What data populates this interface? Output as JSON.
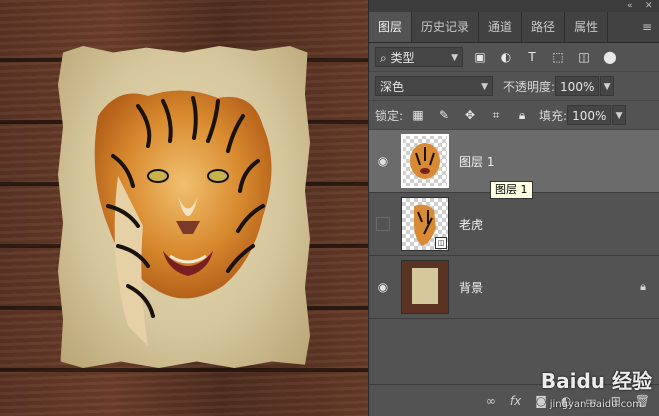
{
  "panel": {
    "tabs": [
      {
        "label": "图层"
      },
      {
        "label": "历史记录"
      },
      {
        "label": "通道"
      },
      {
        "label": "路径"
      },
      {
        "label": "属性"
      }
    ],
    "filter": {
      "label": "类型"
    },
    "blend_mode": {
      "value": "深色"
    },
    "opacity": {
      "label": "不透明度:",
      "value": "100%"
    },
    "lock": {
      "label": "锁定:"
    },
    "fill": {
      "label": "填充:",
      "value": "100%"
    },
    "layers": [
      {
        "name": "图层 1",
        "visible": true,
        "selected": true
      },
      {
        "name": "老虎",
        "visible": false,
        "selected": false
      },
      {
        "name": "背景",
        "visible": true,
        "selected": false,
        "locked": true
      }
    ],
    "tooltip": "图层 1"
  },
  "watermark": {
    "text": "Baidu 经验",
    "sub": "jingyan.baidu.com"
  },
  "colors": {
    "panel_bg": "#535353",
    "selected_row": "#6b6b6b",
    "tooltip_bg": "#ffffe1"
  }
}
